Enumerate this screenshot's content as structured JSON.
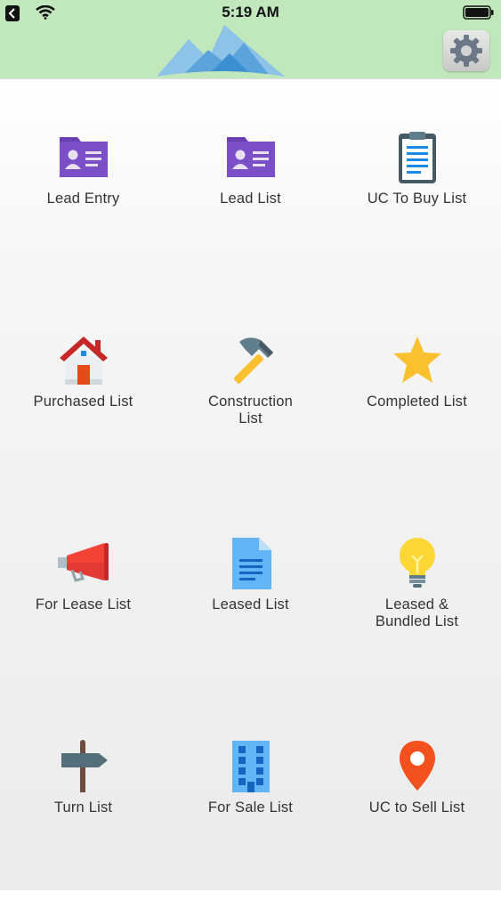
{
  "status_bar": {
    "time": "5:19 AM",
    "icons": [
      "back-icon",
      "wifi-icon",
      "battery-icon"
    ]
  },
  "header": {
    "logo": "mountain-logo-icon",
    "settings_icon": "gear-icon"
  },
  "colors": {
    "header_bg": "#c1e7bd",
    "label_text": "#333333",
    "purple": "#6a3fb5",
    "blue": "#1c87e0",
    "red": "#e53935",
    "yellow": "#fbc02d"
  },
  "menu": {
    "items": [
      {
        "label": "Lead Entry",
        "icon": "contact-card-icon"
      },
      {
        "label": "Lead List",
        "icon": "contact-card-icon"
      },
      {
        "label": "UC To Buy List",
        "icon": "clipboard-icon"
      },
      {
        "label": "Purchased List",
        "icon": "house-icon"
      },
      {
        "label": "Construction\nList",
        "icon": "hammer-icon"
      },
      {
        "label": "Completed List",
        "icon": "star-icon"
      },
      {
        "label": "For Lease List",
        "icon": "megaphone-icon"
      },
      {
        "label": "Leased List",
        "icon": "document-icon"
      },
      {
        "label": "Leased &\nBundled List",
        "icon": "lightbulb-icon"
      },
      {
        "label": "Turn List",
        "icon": "signpost-icon"
      },
      {
        "label": "For Sale List",
        "icon": "building-icon"
      },
      {
        "label": "UC to Sell List",
        "icon": "map-pin-icon"
      }
    ]
  }
}
